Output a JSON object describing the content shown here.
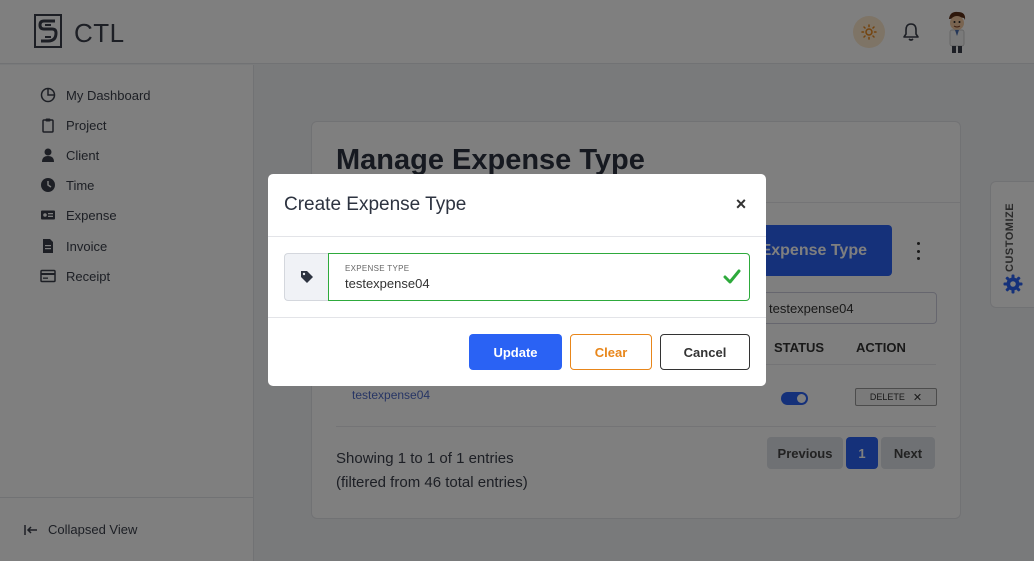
{
  "header": {
    "brand": "CTL"
  },
  "sidebar": {
    "items": [
      {
        "label": "My Dashboard",
        "icon": "pie-chart-icon"
      },
      {
        "label": "Project",
        "icon": "clipboard-icon"
      },
      {
        "label": "Client",
        "icon": "user-icon"
      },
      {
        "label": "Time",
        "icon": "clock-icon"
      },
      {
        "label": "Expense",
        "icon": "money-icon"
      },
      {
        "label": "Invoice",
        "icon": "file-invoice-icon"
      },
      {
        "label": "Receipt",
        "icon": "receipt-icon"
      }
    ],
    "collapse_label": "Collapsed View"
  },
  "main": {
    "title": "Manage Expense Type",
    "add_button": "Expense Type",
    "search_value": "testexpense04",
    "table": {
      "columns": [
        "STATUS",
        "ACTION"
      ],
      "rows": [
        {
          "name": "testexpense04",
          "status_on": true,
          "action": "DELETE"
        }
      ]
    },
    "info_line1": "Showing 1 to 1 of 1 entries",
    "info_line2": "(filtered from 46 total entries)",
    "pagination": {
      "previous": "Previous",
      "current": "1",
      "next": "Next"
    }
  },
  "customize": {
    "label": "CUSTOMIZE"
  },
  "modal": {
    "title": "Create Expense Type",
    "close": "×",
    "field_label": "EXPENSE TYPE",
    "field_value": "testexpense04",
    "update": "Update",
    "clear": "Clear",
    "cancel": "Cancel"
  },
  "colors": {
    "primary": "#2a62f4",
    "success": "#2eaa3c",
    "warning": "#e8861a",
    "link": "#4f6bc9"
  }
}
